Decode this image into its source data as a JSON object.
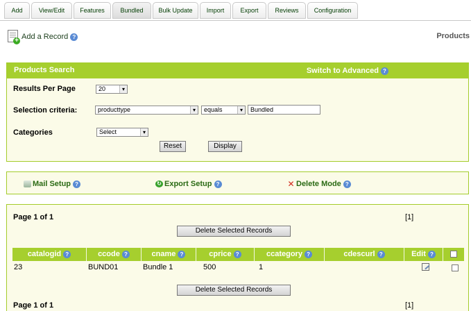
{
  "tabs": [
    {
      "label": "Add"
    },
    {
      "label": "View/Edit"
    },
    {
      "label": "Features"
    },
    {
      "label": "Bundled"
    },
    {
      "label": "Bulk Update"
    },
    {
      "label": "Import"
    },
    {
      "label": "Export"
    },
    {
      "label": "Reviews"
    },
    {
      "label": "Configuration"
    }
  ],
  "active_tab": "Bundled",
  "header": {
    "add_record_label": "Add a Record",
    "breadcrumb": "Products"
  },
  "search": {
    "title": "Products  Search",
    "switch_label": "Switch to Advanced",
    "results_per_page_label": "Results Per Page",
    "results_per_page_value": "20",
    "selection_label": "Selection criteria:",
    "field_value": "producttype",
    "operator_value": "equals",
    "criteria_value": "Bundled",
    "categories_label": "Categories",
    "categories_value": "Select",
    "reset_label": "Reset",
    "display_label": "Display"
  },
  "tools": {
    "mail_label": "Mail Setup",
    "export_label": "Export Setup",
    "delete_label": "Delete Mode"
  },
  "results": {
    "page_info_top": "Page 1 of 1",
    "page_info_bottom": "Page 1 of 1",
    "page_link": "[1]",
    "delete_selected_label": "Delete Selected Records",
    "columns": [
      "catalogid",
      "ccode",
      "cname",
      "cprice",
      "ccategory",
      "cdescurl",
      "Edit"
    ],
    "rows": [
      {
        "catalogid": "23",
        "ccode": "BUND01",
        "cname": "Bundle 1",
        "cprice": "500",
        "ccategory": "1",
        "cdescurl": ""
      }
    ]
  },
  "colors": {
    "accent_green": "#a6cf2e",
    "panel_bg": "#fbfbe8",
    "link_green": "#2b6a14"
  }
}
